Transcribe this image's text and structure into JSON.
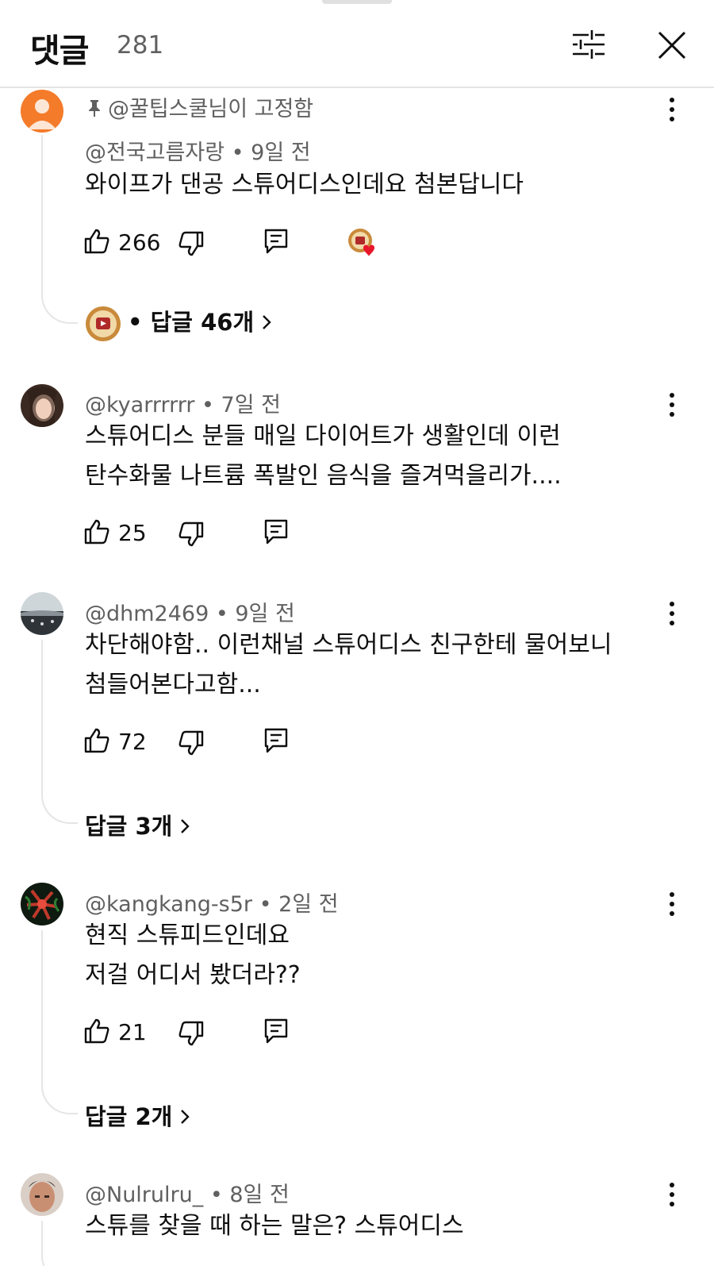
{
  "header": {
    "title": "댓글",
    "count": "281",
    "filter_icon": "sliders-icon",
    "close_icon": "close-icon"
  },
  "comments": [
    {
      "pinned_label": "@꿀팁스쿨님이 고정함",
      "author": "@전국고름자랑",
      "time": "9일 전",
      "lines": [
        "와이프가 댄공 스튜어디스인데요 첨본답니다"
      ],
      "likes": "266",
      "creator_hearted": true,
      "replies_label": "• 답글 46개",
      "avatar_color": "#f47b2a"
    },
    {
      "author": "@kyarrrrrr",
      "time": "7일 전",
      "lines": [
        "스튜어디스 분들 매일 다이어트가 생활인데 이런",
        "탄수화물 나트륨 폭발인 음식을 즐겨먹을리가...."
      ],
      "likes": "25"
    },
    {
      "author": "@dhm2469",
      "time": "9일 전",
      "lines": [
        "차단해야함.. 이런채널 스튜어디스 친구한테 물어보니",
        "첨들어본다고함..."
      ],
      "likes": "72",
      "replies_label": "답글 3개"
    },
    {
      "author": "@kangkang-s5r",
      "time": "2일 전",
      "lines": [
        "현직 스튜피드인데요",
        "저걸 어디서 봤더라??"
      ],
      "likes": "21",
      "replies_label": "답글 2개"
    },
    {
      "author": "@Nulrulru_",
      "time": "8일 전",
      "lines": [
        "스튜를 찾을 때 하는 말은? 스튜어디스"
      ]
    }
  ]
}
